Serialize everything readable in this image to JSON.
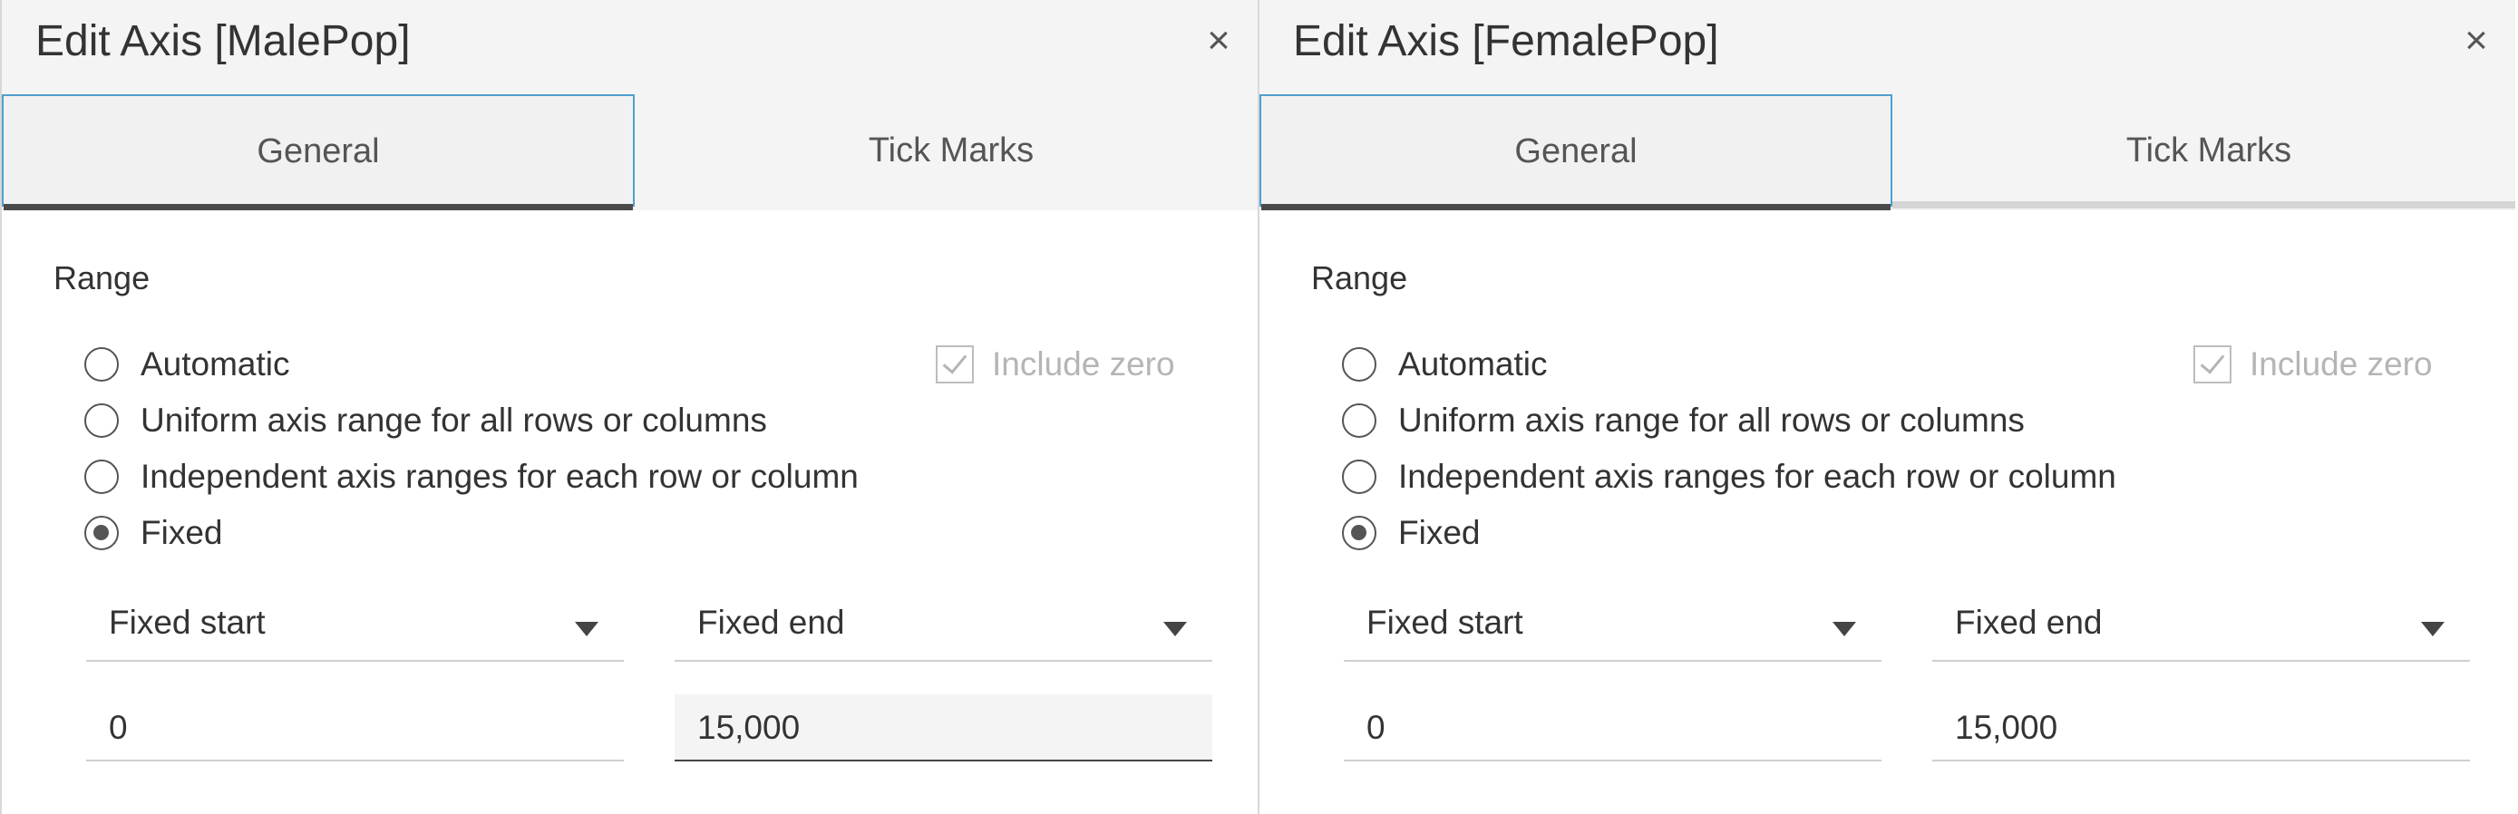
{
  "panels": [
    {
      "title": "Edit Axis [MalePop]",
      "close_glyph": "×",
      "tabs": {
        "general": "General",
        "tick_marks": "Tick Marks"
      },
      "active_tab": "General",
      "range": {
        "label": "Range",
        "options": [
          {
            "label": "Automatic",
            "checked": false
          },
          {
            "label": "Uniform axis range for all rows or columns",
            "checked": false
          },
          {
            "label": "Independent axis ranges for each row or column",
            "checked": false
          },
          {
            "label": "Fixed",
            "checked": true
          }
        ],
        "include_zero": {
          "label": "Include zero",
          "checked": true,
          "disabled": true
        },
        "start_mode": "Fixed start",
        "end_mode": "Fixed end",
        "start_value": "0",
        "end_value": "15,000"
      }
    },
    {
      "title": "Edit Axis [FemalePop]",
      "close_glyph": "×",
      "tabs": {
        "general": "General",
        "tick_marks": "Tick Marks"
      },
      "active_tab": "General",
      "range": {
        "label": "Range",
        "options": [
          {
            "label": "Automatic",
            "checked": false
          },
          {
            "label": "Uniform axis range for all rows or columns",
            "checked": false
          },
          {
            "label": "Independent axis ranges for each row or column",
            "checked": false
          },
          {
            "label": "Fixed",
            "checked": true
          }
        ],
        "include_zero": {
          "label": "Include zero",
          "checked": true,
          "disabled": true
        },
        "start_mode": "Fixed start",
        "end_mode": "Fixed end",
        "start_value": "0",
        "end_value": "15,000"
      }
    }
  ],
  "icons": {
    "close": "close-icon",
    "dropdown": "chevron-down-icon"
  },
  "colors": {
    "active_tab_border": "#4f9fcf",
    "active_tab_underline": "#4a4a4a",
    "header_background": "#f4f4f4",
    "disabled_text": "#b5b5b5"
  }
}
